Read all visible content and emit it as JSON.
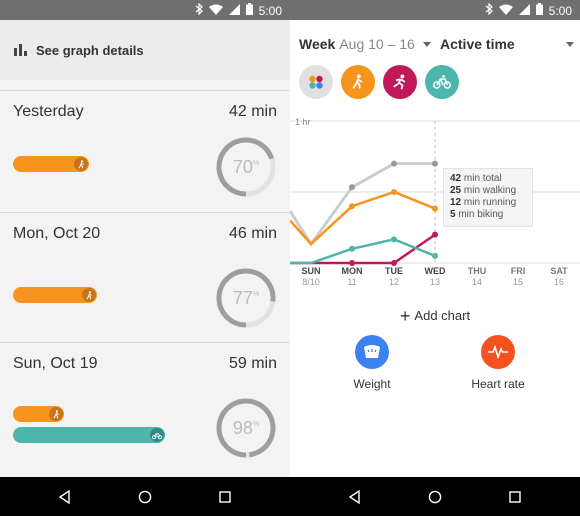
{
  "status_bar": {
    "time_left": "5:00",
    "time_right": "5:00"
  },
  "left": {
    "graph_details_label": "See graph details",
    "days": [
      {
        "label": "Yesterday",
        "minutes": "42 min",
        "goal_percent": "70",
        "goal_fraction": 0.7,
        "activities": [
          {
            "type": "walking",
            "color": "#f7941d",
            "knob": "#c8741a",
            "fraction": 0.4
          }
        ]
      },
      {
        "label": "Mon, Oct 20",
        "minutes": "46 min",
        "goal_percent": "77",
        "goal_fraction": 0.77,
        "activities": [
          {
            "type": "walking",
            "color": "#f7941d",
            "knob": "#c8741a",
            "fraction": 0.44
          }
        ]
      },
      {
        "label": "Sun, Oct 19",
        "minutes": "59 min",
        "goal_percent": "98",
        "goal_fraction": 0.98,
        "activities": [
          {
            "type": "walking",
            "color": "#f7941d",
            "knob": "#c8741a",
            "fraction": 0.27
          },
          {
            "type": "biking",
            "color": "#4db6ac",
            "knob": "#2e8a82",
            "fraction": 0.8
          }
        ]
      }
    ]
  },
  "right": {
    "period_label": "Week",
    "period_range": "Aug 10 – 16",
    "metric_label": "Active time",
    "filters": [
      {
        "name": "all",
        "color": "#e0e0e0"
      },
      {
        "name": "walking",
        "color": "#f7941d"
      },
      {
        "name": "running",
        "color": "#c2185b"
      },
      {
        "name": "biking",
        "color": "#4db6ac"
      }
    ],
    "add_chart_label": "Add chart",
    "bottom_items": [
      {
        "label": "Weight",
        "color": "#3b82f0"
      },
      {
        "label": "Heart rate",
        "color": "#f4511e"
      }
    ]
  },
  "chart_data": {
    "type": "line",
    "y_label_top": "1 hr",
    "ylim": [
      0,
      60
    ],
    "categories": [
      {
        "day": "SUN",
        "date": "8/10"
      },
      {
        "day": "MON",
        "date": "11"
      },
      {
        "day": "TUE",
        "date": "12"
      },
      {
        "day": "WED",
        "date": "13"
      },
      {
        "day": "THU",
        "date": "14"
      },
      {
        "day": "FRI",
        "date": "15"
      },
      {
        "day": "SAT",
        "date": "16"
      }
    ],
    "series": [
      {
        "name": "total",
        "color": "#cccccc",
        "values": [
          8,
          32,
          42,
          42
        ]
      },
      {
        "name": "walking",
        "color": "#f7941d",
        "values": [
          8,
          24,
          30,
          23
        ]
      },
      {
        "name": "running",
        "color": "#c2185b",
        "values": [
          0,
          0,
          0,
          12
        ]
      },
      {
        "name": "biking",
        "color": "#4db6ac",
        "values": [
          0,
          6,
          10,
          3
        ]
      }
    ],
    "selected_index": 3,
    "tooltip": [
      {
        "value": "42",
        "text": "min total"
      },
      {
        "value": "25",
        "text": "min walking"
      },
      {
        "value": "12",
        "text": "min running"
      },
      {
        "value": "5",
        "text": "min biking"
      }
    ]
  }
}
